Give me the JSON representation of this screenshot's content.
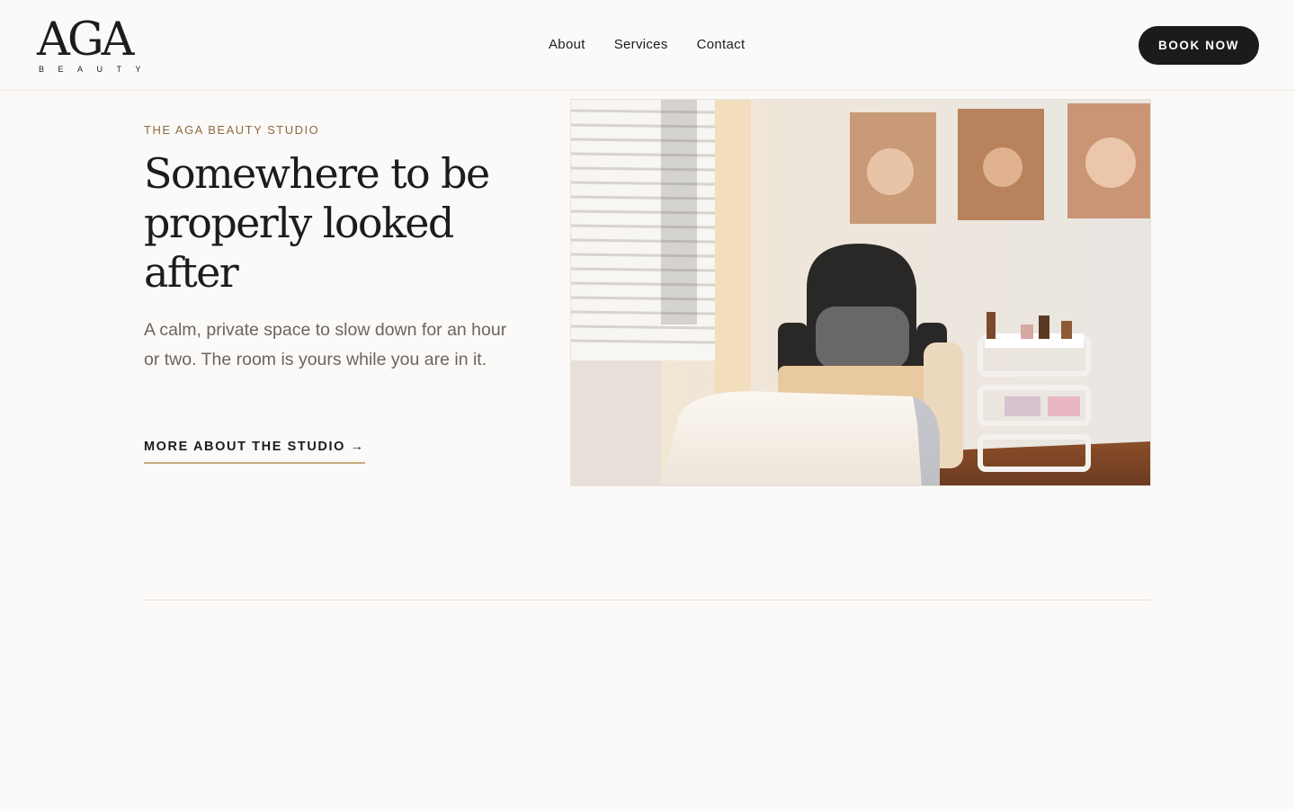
{
  "header": {
    "logo_main": "AGA",
    "logo_sub": "BEAUTY",
    "nav": [
      {
        "label": "About"
      },
      {
        "label": "Services"
      },
      {
        "label": "Contact"
      }
    ],
    "book_label": "BOOK NOW"
  },
  "hero": {
    "eyebrow": "THE AGA BEAUTY STUDIO",
    "title": "Somewhere to be properly looked after",
    "lede": "A calm, private space to slow down for an hour or two. The room is yours while you are in it.",
    "link_label": "MORE ABOUT THE STUDIO",
    "link_arrow": "→"
  },
  "colors": {
    "background": "#fcfaf8",
    "accent": "#8a6a42",
    "underline": "#c9a97e",
    "button": "#1d1b1a"
  }
}
